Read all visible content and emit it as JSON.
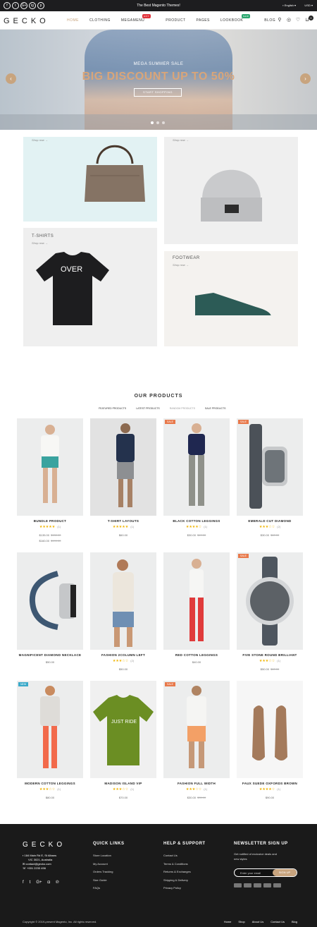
{
  "topbar": {
    "social": [
      "f",
      "t",
      "G+",
      "ig",
      "p"
    ],
    "promo": "The Best Magento Themes!",
    "language": "English",
    "currency": "USD"
  },
  "header": {
    "logo": "GECKO",
    "nav": [
      "HOME",
      "CLOTHING",
      "MEGAMENU",
      "PRODUCT",
      "PAGES",
      "LOOKBOOK",
      "BLOG"
    ],
    "hot": "HOT",
    "new": "NEW",
    "cart_count": "0"
  },
  "hero": {
    "subtitle": "MEGA SUMMER SALE",
    "title": "BIG DISCOUNT UP TO 50%",
    "button": "START SHOPPING"
  },
  "categories": [
    {
      "name": "",
      "shop": "Shop now →"
    },
    {
      "name": "",
      "shop": "Shop now →"
    },
    {
      "name": "T-SHIRTS",
      "shop": "Shop now →"
    },
    {
      "name": "FOOTWEAR",
      "shop": "Shop now →"
    }
  ],
  "products_section": {
    "title": "OUR PRODUCTS",
    "tabs": [
      "FEATURED PRODUCTS",
      "LATEST PRODUCTS",
      "RANDOM PRODUCTS",
      "SALE PRODUCTS"
    ]
  },
  "products": [
    {
      "name": "BUNDLE PRODUCT",
      "stars": "★★★★★",
      "count": "(1)",
      "price": "$135.00",
      "old": "$150.00",
      "price2": "$160.00",
      "old2": "$199.00",
      "tag": ""
    },
    {
      "name": "T-SHIRT LAYOUTS",
      "stars": "★★★★★",
      "count": "(1)",
      "price": "$60.00",
      "old": "",
      "tag": ""
    },
    {
      "name": "BLACK COTTON LEGGINGS",
      "stars": "★★★★☆",
      "count": "(1)",
      "price": "$30.00",
      "old": "$49.00",
      "tag": "SALE"
    },
    {
      "name": "EMERALD CUT DIAMOND",
      "stars": "★★★☆☆",
      "count": "(2)",
      "price": "$30.00",
      "old": "$60.00",
      "tag": "SALE"
    },
    {
      "name": "MAGNIFICENT DIAMOND NECKLACE",
      "stars": "",
      "count": "",
      "price": "$50.00",
      "old": "",
      "tag": ""
    },
    {
      "name": "FASHION 2COLUMN LEFT",
      "stars": "★★★☆☆",
      "count": "(2)",
      "price": "$50.00",
      "old": "",
      "tag": ""
    },
    {
      "name": "RED COTTON LEGGINGS",
      "stars": "",
      "count": "",
      "price": "$40.00",
      "old": "",
      "tag": ""
    },
    {
      "name": "FIVE STONE ROUND BRILLIANT",
      "stars": "★★★☆☆",
      "count": "(1)",
      "price": "$50.00",
      "old": "$60.00",
      "tag": "SALE"
    },
    {
      "name": "MODERN COTTON LEGGINGS",
      "stars": "★★★☆☆",
      "count": "(1)",
      "price": "$80.00",
      "old": "",
      "tag": "NEW"
    },
    {
      "name": "MADISON ISLAND VIP",
      "stars": "★★★☆☆",
      "count": "(1)",
      "price": "$70.00",
      "old": "",
      "tag": ""
    },
    {
      "name": "FASHION FULL WIDTH",
      "stars": "★★★☆☆",
      "count": "(1)",
      "price": "$30.00",
      "old": "$35.00",
      "tag": "SALE"
    },
    {
      "name": "FAUX SUEDE OXFORDS BROWN",
      "stars": "★★★★☆",
      "count": "(1)",
      "price": "$90.00",
      "old": "",
      "tag": ""
    }
  ],
  "footer": {
    "logo": "GECKO",
    "address_line1": "184 Main Rd E, St Albans",
    "address_line2": "VIC 3021, Australia",
    "email": "contact@gecko.com",
    "phone": "+001 2233 456",
    "quick_links_title": "QUICK LINKS",
    "quick_links": [
      "Store Location",
      "My Account",
      "Orders Tracking",
      "Size Guide",
      "FAQs"
    ],
    "help_title": "HELP & SUPPORT",
    "help_links": [
      "Contact Us",
      "Terms & Conditions",
      "Returns & Exchanges",
      "Shipping & Delivery",
      "Privacy Policy"
    ],
    "newsletter_title": "NEWSLETTER SIGN UP",
    "newsletter_text1": "Get notified of exclusive deals and",
    "newsletter_text2": "new styles",
    "email_placeholder": "Enter your email",
    "signup": "SIGN UP",
    "copyright": "Copyright © 2019-present Magento, Inc. All rights reserved.",
    "bottom_links": [
      "Home",
      "Shop",
      "About Us",
      "Contact Us",
      "Blog"
    ]
  },
  "colors": {
    "accent": "#c8a47e",
    "dark": "#1d1d1f",
    "sale": "#e8794b",
    "new": "#3aa9c9"
  }
}
